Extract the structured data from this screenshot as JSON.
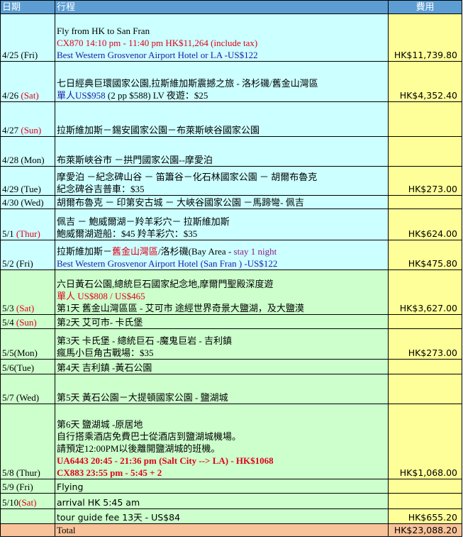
{
  "header": {
    "date": "日期",
    "itinerary": "行程",
    "fee": "費用"
  },
  "rows": [
    {
      "date": "4/25 (Fri)",
      "lines": [
        "Fly from HK to San Fran",
        "CX870 14:10 pm - 11:40 pm  HK$11,264 (include tax)",
        "Best Western Grosvenor Airport Hotel   or LA  -US$122"
      ],
      "fee": "HK$11,739.80"
    },
    {
      "date": "4/26 ",
      "date_colored": "(Sat)",
      "lines": [
        "七日經典巨環國家公園,拉斯維加斯震撼之旅 - 洛杉磯/舊金山灣區",
        "單人US$958",
        " (2 pp $588) LV 夜遊：$25"
      ],
      "fee": "HK$4,352.40"
    },
    {
      "date": "4/27 ",
      "date_colored": "(Sun)",
      "lines": [
        "拉斯維加斯－錫安國家公園－布萊斯峽谷國家公園"
      ],
      "fee": ""
    },
    {
      "date": "4/28 (Mon)",
      "lines": [
        "布萊斯峽谷市 －拱門國家公園--摩愛泊"
      ],
      "fee": ""
    },
    {
      "date": "4/29 (Tue)",
      "lines": [
        "摩愛泊 －紀念碑山谷 － 笛簫谷－化石林國家公園 － 胡爾布魯克",
        "紀念碑谷吉普車：$35"
      ],
      "fee": "HK$273.00"
    },
    {
      "date": "4/30 (Wed)",
      "lines": [
        "胡爾布魯克 － 印第安古城  － 大峽谷國家公園 －馬蹄彎- 佩吉"
      ],
      "fee": ""
    },
    {
      "date": "5/1 ",
      "date_colored": "(Thur)",
      "lines": [
        "佩吉 － 鮑威爾湖－羚羊彩穴－ 拉斯維加斯",
        "鮑威爾湖遊船：$45  羚羊彩穴：$35"
      ],
      "fee": "HK$624.00"
    },
    {
      "date": "5/2  (Fri)",
      "lines": [
        "拉斯維加斯－",
        "舊金山灣區",
        "/洛杉磯(Bay Area - ",
        "stay 1 night",
        "Best Western Grosvenor Airport Hotel   (San Fran )  -US$122"
      ],
      "fee": "HK$475.80"
    },
    {
      "date": "5/3 ",
      "date_colored": "(Sat)",
      "lines": [
        "六日黃石公園,總統巨石國家紀念地,摩爾門聖殿深度遊",
        "單人 US$808 /  US$465",
        "第1天 舊金山灣區區 - 艾可市 途經世界奇景大鹽湖，及大鹽漠"
      ],
      "fee": "HK$3,627.00"
    },
    {
      "date": "5/4 ",
      "date_colored": "(Sun)",
      "lines": [
        "第2天 艾可市- 卡氏堡"
      ],
      "fee": ""
    },
    {
      "date": "5/5(Mon)",
      "lines": [
        "第3天 卡氏堡 - 總統巨石 -魔鬼巨岩 -  吉利鎮",
        "瘋馬小巨角古戰場：$35"
      ],
      "fee": "HK$273.00"
    },
    {
      "date": "5/6(Tue)",
      "lines": [
        "第4天 吉利鎮 -黃石公園"
      ],
      "fee": ""
    },
    {
      "date": "5/7 (Wed)",
      "lines": [
        "第5天 黃石公園－大提頓國家公園  - 鹽湖城"
      ],
      "fee": ""
    },
    {
      "date": "5/8 (Thur)",
      "lines": [
        "第6天 鹽湖城 -原居地",
        "自行搭乘酒店免費巴士從酒店到鹽湖城機場。",
        "請預定12:00PM以後離開鹽湖城的班機。",
        "UA6443 20:45 - 21:36 pm (Salt City --> LA) - HK$1068",
        "CX883 23:55 pm - 5:45 + 2"
      ],
      "fee": "HK$1,068.00"
    },
    {
      "date": "5/9 (Fri)",
      "lines": [
        "Flying"
      ],
      "fee": ""
    },
    {
      "date": "5/10",
      "date_colored": "(Sat)",
      "lines": [
        "arrival HK 5:45 am"
      ],
      "fee": ""
    },
    {
      "date": "",
      "lines": [
        "tour guide fee 13天 - US$84"
      ],
      "fee": "HK$655.20"
    }
  ],
  "total": {
    "label": "Total",
    "fee": "HK$23,088.20"
  },
  "colors": {
    "header": "#5c9ed3",
    "cyan": "#ccffff",
    "green": "#ccffcc",
    "fee": "#ffff99",
    "total": "#f8c39a",
    "red": "#e0001a",
    "blue": "#1a1aa6"
  }
}
